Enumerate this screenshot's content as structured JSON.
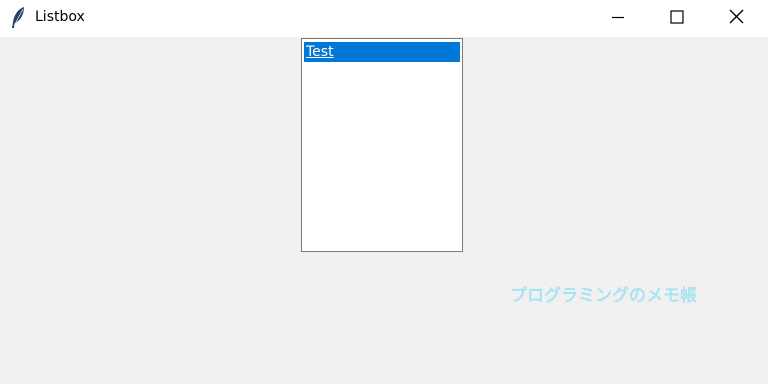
{
  "window": {
    "title": "Listbox",
    "icon": "feather-icon",
    "controls": {
      "minimize_icon": "minimize-icon",
      "maximize_icon": "maximize-icon",
      "close_icon": "close-icon"
    }
  },
  "listbox": {
    "items": [
      {
        "label": "Test",
        "selected": true
      }
    ],
    "selection_color": "#0078d7"
  },
  "watermark": {
    "text": "プログラミングのメモ帳",
    "color": "#a8e3f2"
  }
}
